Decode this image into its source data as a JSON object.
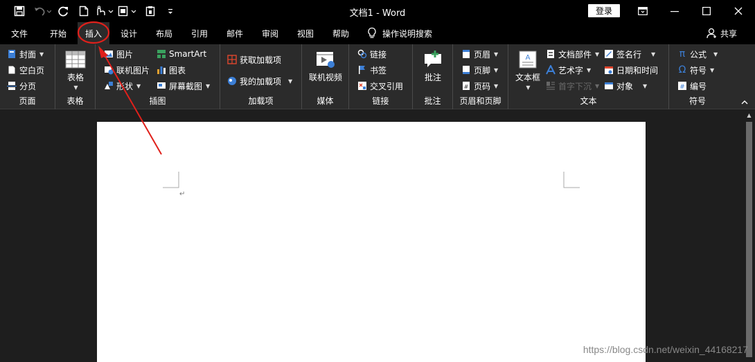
{
  "window": {
    "title": "文档1  -  Word",
    "login_label": "登录"
  },
  "tabs": [
    {
      "label": "文件"
    },
    {
      "label": "开始"
    },
    {
      "label": "插入"
    },
    {
      "label": "设计"
    },
    {
      "label": "布局"
    },
    {
      "label": "引用"
    },
    {
      "label": "邮件"
    },
    {
      "label": "审阅"
    },
    {
      "label": "视图"
    },
    {
      "label": "帮助"
    }
  ],
  "active_tab": "插入",
  "tell_me": "操作说明搜索",
  "share": "共享",
  "ribbon": {
    "pages": {
      "label": "页面",
      "cover": "封面",
      "blank": "空白页",
      "break": "分页"
    },
    "tables": {
      "label": "表格",
      "table": "表格"
    },
    "illustrations": {
      "label": "插图",
      "pictures": "图片",
      "online_pictures": "联机图片",
      "shapes": "形状",
      "smartart": "SmartArt",
      "chart": "图表",
      "screenshot": "屏幕截图"
    },
    "addins": {
      "label": "加载项",
      "get": "获取加载项",
      "my": "我的加载项"
    },
    "media": {
      "label": "媒体",
      "online_video": "联机视频"
    },
    "links": {
      "label": "链接",
      "link": "链接",
      "bookmark": "书签",
      "crossref": "交叉引用"
    },
    "comments": {
      "label": "批注",
      "comment": "批注"
    },
    "header_footer": {
      "label": "页眉和页脚",
      "header": "页眉",
      "footer": "页脚",
      "page_number": "页码"
    },
    "text": {
      "label": "文本",
      "textbox": "文本框",
      "quick_parts": "文档部件",
      "wordart": "艺术字",
      "dropcap": "首字下沉",
      "signature": "签名行",
      "datetime": "日期和时间",
      "object": "对象"
    },
    "symbols": {
      "label": "符号",
      "equation": "公式",
      "symbol": "符号",
      "number": "编号"
    }
  },
  "watermark": "https://blog.csdn.net/weixin_44168217",
  "colors": {
    "background": "#000000",
    "ribbon": "#2b2b2b",
    "document_bg": "#1e1e1e",
    "page": "#ffffff",
    "annotation_red": "#e0201b",
    "accent_blue": "#4a90d9"
  },
  "icons": [
    "save-icon",
    "undo-icon",
    "redo-icon",
    "new-doc-icon",
    "touch-mode-icon",
    "print-preview-icon",
    "customize-qat-icon",
    "lightbulb-icon",
    "person-icon"
  ]
}
